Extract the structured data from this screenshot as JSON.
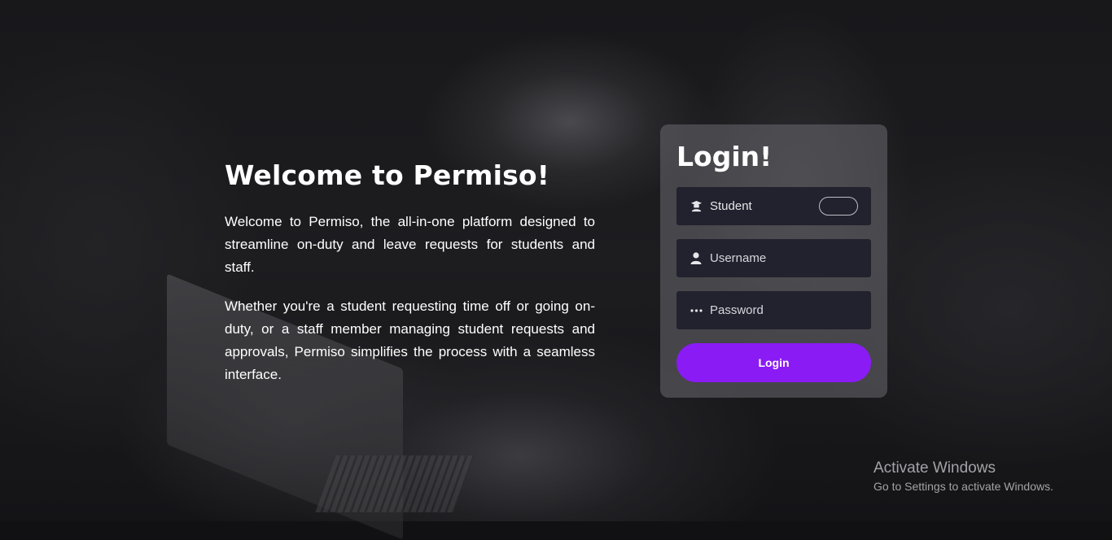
{
  "hero": {
    "title": "Welcome to Permiso!",
    "paragraph_1": "Welcome to Permiso, the all-in-one platform designed to streamline on-duty and leave requests for students and staff.",
    "paragraph_2": "Whether you're a student requesting time off or going on-duty, or a staff member managing student requests and approvals, Permiso simplifies the process with a seamless interface."
  },
  "login": {
    "title": "Login!",
    "role_label": "Student",
    "role_icon": "graduate-icon",
    "role_toggle_on": false,
    "username_placeholder": "Username",
    "username_icon": "user-icon",
    "password_placeholder": "Password",
    "password_icon": "password-dots-icon",
    "button_label": "Login",
    "accent_color": "#8a1bf5"
  },
  "watermark": {
    "line_1": "Activate Windows",
    "line_2": "Go to Settings to activate Windows."
  }
}
